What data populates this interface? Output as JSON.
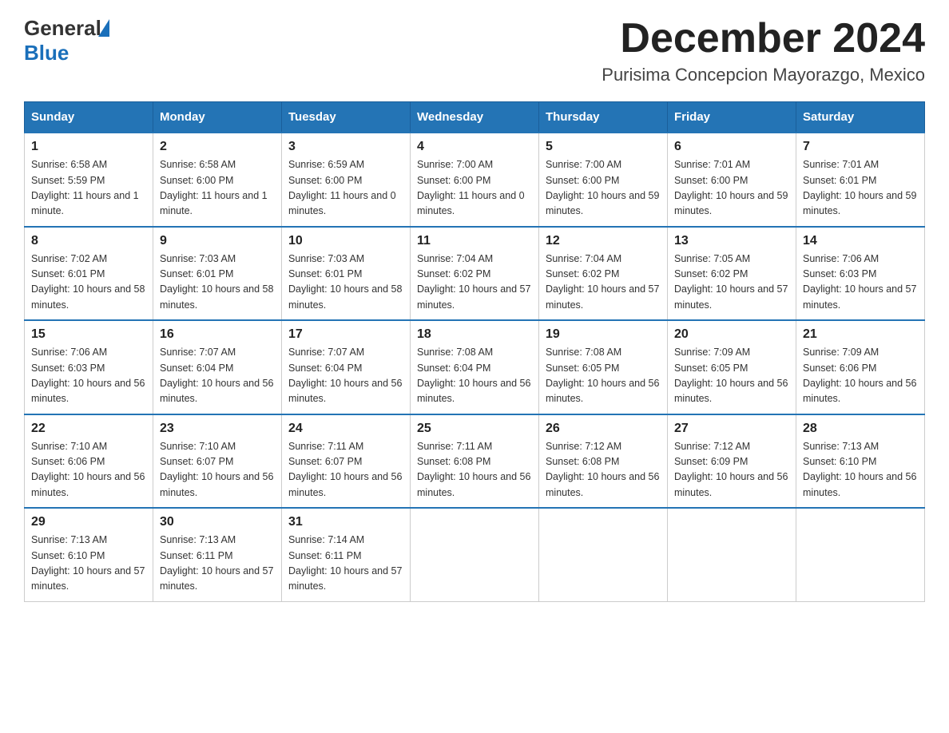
{
  "header": {
    "logo": {
      "general": "General",
      "blue": "Blue"
    },
    "title": "December 2024",
    "location": "Purisima Concepcion Mayorazgo, Mexico"
  },
  "weekdays": [
    "Sunday",
    "Monday",
    "Tuesday",
    "Wednesday",
    "Thursday",
    "Friday",
    "Saturday"
  ],
  "weeks": [
    [
      {
        "day": "1",
        "sunrise": "6:58 AM",
        "sunset": "5:59 PM",
        "daylight": "11 hours and 1 minute."
      },
      {
        "day": "2",
        "sunrise": "6:58 AM",
        "sunset": "6:00 PM",
        "daylight": "11 hours and 1 minute."
      },
      {
        "day": "3",
        "sunrise": "6:59 AM",
        "sunset": "6:00 PM",
        "daylight": "11 hours and 0 minutes."
      },
      {
        "day": "4",
        "sunrise": "7:00 AM",
        "sunset": "6:00 PM",
        "daylight": "11 hours and 0 minutes."
      },
      {
        "day": "5",
        "sunrise": "7:00 AM",
        "sunset": "6:00 PM",
        "daylight": "10 hours and 59 minutes."
      },
      {
        "day": "6",
        "sunrise": "7:01 AM",
        "sunset": "6:00 PM",
        "daylight": "10 hours and 59 minutes."
      },
      {
        "day": "7",
        "sunrise": "7:01 AM",
        "sunset": "6:01 PM",
        "daylight": "10 hours and 59 minutes."
      }
    ],
    [
      {
        "day": "8",
        "sunrise": "7:02 AM",
        "sunset": "6:01 PM",
        "daylight": "10 hours and 58 minutes."
      },
      {
        "day": "9",
        "sunrise": "7:03 AM",
        "sunset": "6:01 PM",
        "daylight": "10 hours and 58 minutes."
      },
      {
        "day": "10",
        "sunrise": "7:03 AM",
        "sunset": "6:01 PM",
        "daylight": "10 hours and 58 minutes."
      },
      {
        "day": "11",
        "sunrise": "7:04 AM",
        "sunset": "6:02 PM",
        "daylight": "10 hours and 57 minutes."
      },
      {
        "day": "12",
        "sunrise": "7:04 AM",
        "sunset": "6:02 PM",
        "daylight": "10 hours and 57 minutes."
      },
      {
        "day": "13",
        "sunrise": "7:05 AM",
        "sunset": "6:02 PM",
        "daylight": "10 hours and 57 minutes."
      },
      {
        "day": "14",
        "sunrise": "7:06 AM",
        "sunset": "6:03 PM",
        "daylight": "10 hours and 57 minutes."
      }
    ],
    [
      {
        "day": "15",
        "sunrise": "7:06 AM",
        "sunset": "6:03 PM",
        "daylight": "10 hours and 56 minutes."
      },
      {
        "day": "16",
        "sunrise": "7:07 AM",
        "sunset": "6:04 PM",
        "daylight": "10 hours and 56 minutes."
      },
      {
        "day": "17",
        "sunrise": "7:07 AM",
        "sunset": "6:04 PM",
        "daylight": "10 hours and 56 minutes."
      },
      {
        "day": "18",
        "sunrise": "7:08 AM",
        "sunset": "6:04 PM",
        "daylight": "10 hours and 56 minutes."
      },
      {
        "day": "19",
        "sunrise": "7:08 AM",
        "sunset": "6:05 PM",
        "daylight": "10 hours and 56 minutes."
      },
      {
        "day": "20",
        "sunrise": "7:09 AM",
        "sunset": "6:05 PM",
        "daylight": "10 hours and 56 minutes."
      },
      {
        "day": "21",
        "sunrise": "7:09 AM",
        "sunset": "6:06 PM",
        "daylight": "10 hours and 56 minutes."
      }
    ],
    [
      {
        "day": "22",
        "sunrise": "7:10 AM",
        "sunset": "6:06 PM",
        "daylight": "10 hours and 56 minutes."
      },
      {
        "day": "23",
        "sunrise": "7:10 AM",
        "sunset": "6:07 PM",
        "daylight": "10 hours and 56 minutes."
      },
      {
        "day": "24",
        "sunrise": "7:11 AM",
        "sunset": "6:07 PM",
        "daylight": "10 hours and 56 minutes."
      },
      {
        "day": "25",
        "sunrise": "7:11 AM",
        "sunset": "6:08 PM",
        "daylight": "10 hours and 56 minutes."
      },
      {
        "day": "26",
        "sunrise": "7:12 AM",
        "sunset": "6:08 PM",
        "daylight": "10 hours and 56 minutes."
      },
      {
        "day": "27",
        "sunrise": "7:12 AM",
        "sunset": "6:09 PM",
        "daylight": "10 hours and 56 minutes."
      },
      {
        "day": "28",
        "sunrise": "7:13 AM",
        "sunset": "6:10 PM",
        "daylight": "10 hours and 56 minutes."
      }
    ],
    [
      {
        "day": "29",
        "sunrise": "7:13 AM",
        "sunset": "6:10 PM",
        "daylight": "10 hours and 57 minutes."
      },
      {
        "day": "30",
        "sunrise": "7:13 AM",
        "sunset": "6:11 PM",
        "daylight": "10 hours and 57 minutes."
      },
      {
        "day": "31",
        "sunrise": "7:14 AM",
        "sunset": "6:11 PM",
        "daylight": "10 hours and 57 minutes."
      },
      null,
      null,
      null,
      null
    ]
  ],
  "labels": {
    "sunrise": "Sunrise:",
    "sunset": "Sunset:",
    "daylight": "Daylight:"
  }
}
